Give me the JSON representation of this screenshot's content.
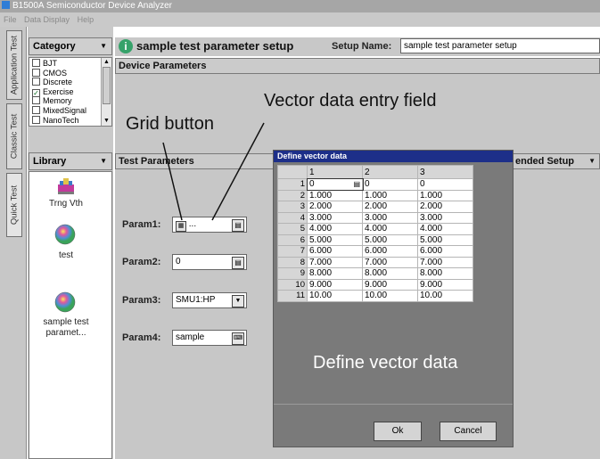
{
  "app": {
    "title": "B1500A Semiconductor Device Analyzer"
  },
  "menu": [
    "File",
    "Data Display",
    "Help"
  ],
  "vtabs": [
    "Application Test",
    "Classic Test",
    "Quick Test"
  ],
  "category": {
    "label": "Category",
    "items": [
      {
        "label": "BJT",
        "checked": false
      },
      {
        "label": "CMOS",
        "checked": false
      },
      {
        "label": "Discrete",
        "checked": false
      },
      {
        "label": "Exercise",
        "checked": true
      },
      {
        "label": "Memory",
        "checked": false
      },
      {
        "label": "MixedSignal",
        "checked": false
      },
      {
        "label": "NanoTech",
        "checked": false
      }
    ]
  },
  "library": {
    "label": "Library",
    "items": [
      {
        "label": "Trng Vth",
        "icon": "transistor-icon"
      },
      {
        "label": "test",
        "icon": "wafer-icon"
      },
      {
        "label": "sample test paramet...",
        "icon": "wafer-icon"
      }
    ]
  },
  "header": {
    "title": "sample test parameter setup",
    "setup_name_label": "Setup Name:",
    "setup_name_value": "sample test parameter setup"
  },
  "device_params": {
    "label": "Device Parameters"
  },
  "test_params": {
    "label": "Test Parameters",
    "params": [
      {
        "label": "Param1:",
        "value": "...",
        "control": "vector"
      },
      {
        "label": "Param2:",
        "value": "0",
        "control": "entry"
      },
      {
        "label": "Param3:",
        "value": "SMU1:HP",
        "control": "dropdown"
      },
      {
        "label": "Param4:",
        "value": "sample",
        "control": "keyboard"
      }
    ]
  },
  "extended_setup": {
    "label": "ended Setup"
  },
  "callouts": {
    "vector_field": "Vector data entry field",
    "grid_button": "Grid button",
    "define_vector": "Define vector data"
  },
  "dialog": {
    "title": "Define vector data",
    "columns": [
      "1",
      "2",
      "3"
    ],
    "rows": [
      {
        "n": "1",
        "cells": [
          "0",
          "0",
          "0"
        ]
      },
      {
        "n": "2",
        "cells": [
          "1.000",
          "1.000",
          "1.000"
        ]
      },
      {
        "n": "3",
        "cells": [
          "2.000",
          "2.000",
          "2.000"
        ]
      },
      {
        "n": "4",
        "cells": [
          "3.000",
          "3.000",
          "3.000"
        ]
      },
      {
        "n": "5",
        "cells": [
          "4.000",
          "4.000",
          "4.000"
        ]
      },
      {
        "n": "6",
        "cells": [
          "5.000",
          "5.000",
          "5.000"
        ]
      },
      {
        "n": "7",
        "cells": [
          "6.000",
          "6.000",
          "6.000"
        ]
      },
      {
        "n": "8",
        "cells": [
          "7.000",
          "7.000",
          "7.000"
        ]
      },
      {
        "n": "9",
        "cells": [
          "8.000",
          "8.000",
          "8.000"
        ]
      },
      {
        "n": "10",
        "cells": [
          "9.000",
          "9.000",
          "9.000"
        ]
      },
      {
        "n": "11",
        "cells": [
          "10.00",
          "10.00",
          "10.00"
        ]
      }
    ],
    "ok_label": "Ok",
    "cancel_label": "Cancel"
  }
}
